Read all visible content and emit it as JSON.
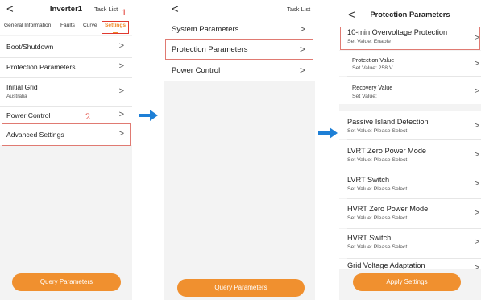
{
  "screen1": {
    "title": "Inverter1",
    "task_list": "Task List",
    "tabs": [
      "General Information",
      "Faults",
      "Curve",
      "Settings"
    ],
    "menu": [
      {
        "label": "Boot/Shutdown",
        "sub": ""
      },
      {
        "label": "Protection Parameters",
        "sub": ""
      },
      {
        "label": "Initial Grid",
        "sub": "Australia"
      },
      {
        "label": "Power Control",
        "sub": ""
      },
      {
        "label": "Advanced Settings",
        "sub": ""
      }
    ],
    "annotations": [
      "1",
      "2"
    ],
    "button": "Query Parameters"
  },
  "screen2": {
    "task_list": "Task List",
    "menu": [
      "System Parameters",
      "Protection Parameters",
      "Power Control"
    ],
    "button": "Query Parameters"
  },
  "screen3": {
    "title": "Protection Parameters",
    "params": [
      {
        "name": "10-min Overvoltage Protection",
        "value": "Set Value: Enable"
      },
      {
        "name": "Protection Value",
        "value": "Set Value: 258 V"
      },
      {
        "name": "Recovery Value",
        "value": "Set Value:"
      },
      {
        "name": "Passive Island Detection",
        "value": "Set Value: Please Select"
      },
      {
        "name": "LVRT Zero Power Mode",
        "value": "Set Value: Please Select"
      },
      {
        "name": "LVRT Switch",
        "value": "Set Value: Please Select"
      },
      {
        "name": "HVRT Zero Power Mode",
        "value": "Set Value: Please Select"
      },
      {
        "name": "HVRT Switch",
        "value": "Set Value: Please Select"
      },
      {
        "name": "Grid Voltage Adaptation",
        "value": ""
      }
    ],
    "button": "Apply Settings"
  },
  "glyphs": {
    "back": "<",
    "chevron": ">"
  },
  "colors": {
    "accent": "#f08a2a",
    "annotation": "#e0392f",
    "arrow": "#1e7fd6"
  }
}
